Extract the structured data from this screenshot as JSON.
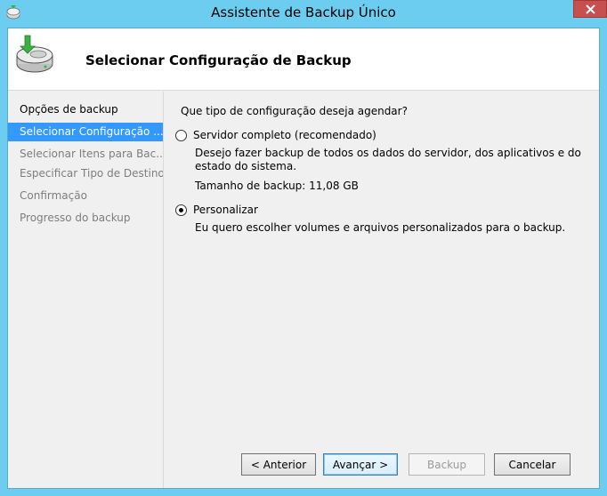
{
  "window": {
    "title": "Assistente de Backup Único",
    "close_icon": "close-icon"
  },
  "header": {
    "title": "Selecionar Configuração de Backup",
    "icon": "backup-disk-icon"
  },
  "nav": {
    "items": [
      {
        "label": "Opções de backup",
        "state": "done"
      },
      {
        "label": "Selecionar Configuração ...",
        "state": "active"
      },
      {
        "label": "Selecionar Itens para Bac...",
        "state": "pending"
      },
      {
        "label": "Especificar Tipo de Destino",
        "state": "pending"
      },
      {
        "label": "Confirmação",
        "state": "pending"
      },
      {
        "label": "Progresso do backup",
        "state": "pending"
      }
    ]
  },
  "main": {
    "question": "Que tipo de configuração deseja agendar?",
    "options": [
      {
        "label": "Servidor completo (recomendado)",
        "checked": false,
        "description": "Desejo fazer backup de todos os dados do servidor, dos aplicativos e do estado do sistema.",
        "size_text": "Tamanho de backup: 11,08 GB"
      },
      {
        "label": "Personalizar",
        "checked": true,
        "description": "Eu quero escolher volumes e arquivos personalizados para o backup."
      }
    ]
  },
  "buttons": {
    "back": "< Anterior",
    "next": "Avançar >",
    "backup": "Backup",
    "cancel": "Cancelar"
  },
  "colors": {
    "frame": "#6dcdf0",
    "selection": "#3399ff",
    "close": "#c7504f"
  }
}
